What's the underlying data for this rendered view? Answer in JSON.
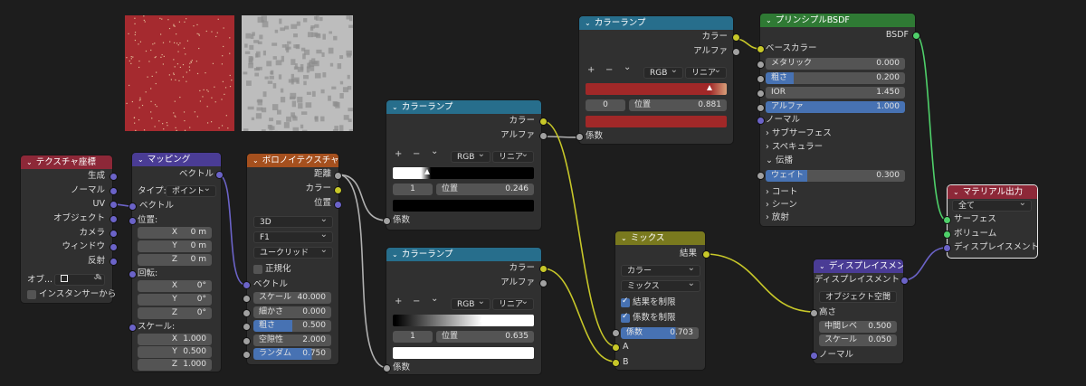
{
  "texture_node": {
    "title": "テクスチャ座標",
    "outputs": [
      "生成",
      "ノーマル",
      "UV",
      "オブジェクト",
      "カメラ",
      "ウィンドウ",
      "反射"
    ],
    "object_label": "オブ...",
    "instancer_label": "インスタンサーから"
  },
  "mapping_node": {
    "title": "マッピング",
    "output": "ベクトル",
    "type_label": "タイプ:",
    "type_value": "ポイント",
    "vector_input": "ベクトル",
    "location_label": "位置:",
    "rotation_label": "回転:",
    "scale_label": "スケール:",
    "location": [
      {
        "k": "X",
        "v": "0 m"
      },
      {
        "k": "Y",
        "v": "0 m"
      },
      {
        "k": "Z",
        "v": "0 m"
      }
    ],
    "rotation": [
      {
        "k": "X",
        "v": "0°"
      },
      {
        "k": "Y",
        "v": "0°"
      },
      {
        "k": "Z",
        "v": "0°"
      }
    ],
    "scale": [
      {
        "k": "X",
        "v": "1.000"
      },
      {
        "k": "Y",
        "v": "0.500"
      },
      {
        "k": "Z",
        "v": "1.000"
      }
    ]
  },
  "voronoi_node": {
    "title": "ボロノイテクスチャ",
    "outputs": [
      "距離",
      "カラー",
      "位置"
    ],
    "dim": "3D",
    "feature": "F1",
    "metric": "ユークリッド",
    "normalize": "正規化",
    "vector_input": "ベクトル",
    "fields": [
      {
        "k": "スケール",
        "v": "40.000",
        "f": "0%"
      },
      {
        "k": "細かさ",
        "v": "0.000",
        "f": "0%"
      },
      {
        "k": "粗さ",
        "v": "0.500",
        "f": "50%"
      },
      {
        "k": "空隙性",
        "v": "2.000",
        "f": "0%"
      },
      {
        "k": "ランダム",
        "v": "0.750",
        "f": "75%"
      }
    ]
  },
  "ramp1": {
    "title": "カラーランプ",
    "out_color": "カラー",
    "out_alpha": "アルファ",
    "mode": "RGB",
    "interp": "リニア",
    "index": "1",
    "pos_label": "位置",
    "pos_value": "0.246",
    "in_fac": "係数",
    "stop_pos": 0.246
  },
  "ramp2": {
    "title": "カラーランプ",
    "out_color": "カラー",
    "out_alpha": "アルファ",
    "mode": "RGB",
    "interp": "リニア",
    "index": "1",
    "pos_label": "位置",
    "pos_value": "0.635",
    "in_fac": "係数",
    "stop_pos": 0.635
  },
  "ramp3": {
    "title": "カラーランプ",
    "out_color": "カラー",
    "out_alpha": "アルファ",
    "mode": "RGB",
    "interp": "リニア",
    "index": "0",
    "pos_label": "位置",
    "pos_value": "0.881",
    "in_fac": "係数",
    "stop_pos": 0.881
  },
  "mix_node": {
    "title": "ミックス",
    "output": "結果",
    "type": "カラー",
    "blend": "ミックス",
    "clamp_result": "結果を制限",
    "clamp_factor": "係数を制限",
    "fac_label": "係数",
    "fac_value": "0.703",
    "fac": 0.703,
    "in_a": "A",
    "in_b": "B"
  },
  "bsdf_node": {
    "title": "プリンシプルBSDF",
    "output": "BSDF",
    "base_color": "ベースカラー",
    "fields": [
      {
        "k": "メタリック",
        "v": "0.000",
        "f": "0%"
      },
      {
        "k": "粗さ",
        "v": "0.200",
        "f": "20%"
      },
      {
        "k": "IOR",
        "v": "1.450",
        "f": "0%"
      },
      {
        "k": "アルファ",
        "v": "1.000",
        "f": "100%"
      }
    ],
    "normal": "ノーマル",
    "subsurface": "サブサーフェス",
    "specular": "スペキュラー",
    "transmission": "伝播",
    "weight_label": "ウェイト",
    "weight_value": "0.300",
    "weight_fill": "30%",
    "coat": "コート",
    "sheen": "シーン",
    "emission": "放射"
  },
  "disp_node": {
    "title": "ディスプレイスメント",
    "output": "ディスプレイスメント",
    "space": "オブジェクト空間",
    "height": "高さ",
    "mid_label": "中間レベ",
    "mid_value": "0.500",
    "scale_label": "スケール",
    "scale_value": "0.050",
    "normal": "ノーマル"
  },
  "output_node": {
    "title": "マテリアル出力",
    "target": "全て",
    "inputs": [
      "サーフェス",
      "ボリューム",
      "ディスプレイスメント"
    ]
  },
  "ramp_toolbar": {
    "plus": "+",
    "minus": "−",
    "down": "⌄"
  },
  "colors": {
    "preview_red": "#a52a2f",
    "preview_gray": "#bdbdbd",
    "ramp3_left": "#a12828",
    "ramp3_right": "#d9a07a"
  }
}
